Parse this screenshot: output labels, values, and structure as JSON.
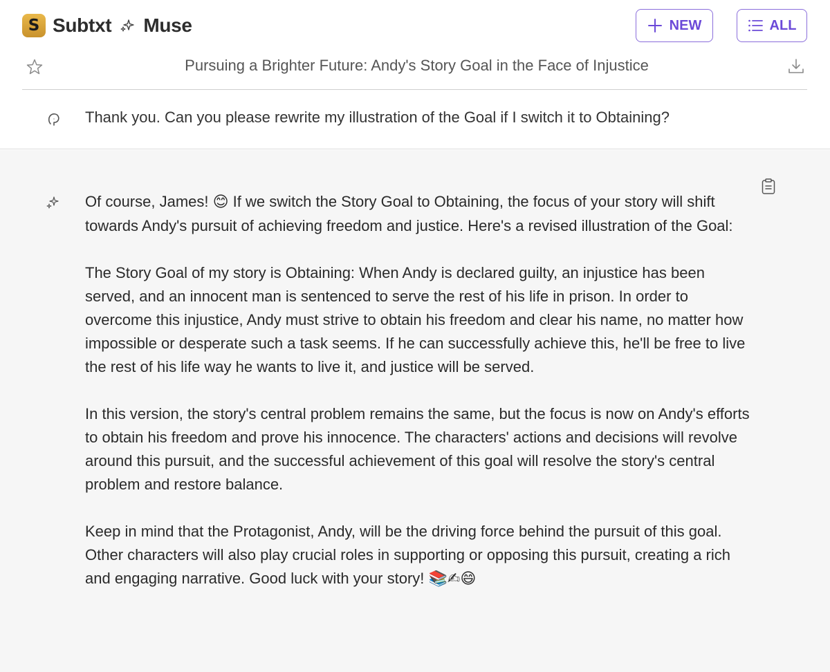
{
  "app": {
    "brand_name": "Subtxt",
    "brand_sub": "Muse",
    "logo_letter": "S",
    "accent": "#6b49d8"
  },
  "toolbar": {
    "new_label": "NEW",
    "all_label": "ALL"
  },
  "conversation": {
    "title": "Pursuing a Brighter Future: Andy's Story Goal in the Face of Injustice"
  },
  "user_message": {
    "text": "Thank you. Can you please rewrite my illustration of the Goal if I switch it to Obtaining?"
  },
  "assistant_message": {
    "p1_before_emoji": "Of course, James! ",
    "p1_emoji": "😊",
    "p1_after_emoji": " If we switch the Story Goal to Obtaining, the focus of your story will shift towards Andy's pursuit of achieving freedom and justice. Here's a revised illustration of the Goal:",
    "p2": "The Story Goal of my story is Obtaining: When Andy is declared guilty, an injustice has been served, and an innocent man is sentenced to serve the rest of his life in prison. In order to overcome this injustice, Andy must strive to obtain his freedom and clear his name, no matter how impossible or desperate such a task seems. If he can successfully achieve this, he'll be free to live the rest of his life way he wants to live it, and justice will be served.",
    "p3": "In this version, the story's central problem remains the same, but the focus is now on Andy's efforts to obtain his freedom and prove his innocence. The characters' actions and decisions will revolve around this pursuit, and the successful achievement of this goal will resolve the story's central problem and restore balance.",
    "p4_text": "Keep in mind that the Protagonist, Andy, will be the driving force behind the pursuit of this goal. Other characters will also play crucial roles in supporting or opposing this pursuit, creating a rich and engaging narrative. Good luck with your story! ",
    "p4_emoji": "📚✍😄"
  },
  "icons": {
    "logo": "subtxt-logo-icon",
    "brand_sparkle": "sparkle-icon",
    "new": "plus-icon",
    "all": "list-icon",
    "favorite": "star-icon",
    "download": "download-icon",
    "user": "user-speech-icon",
    "assistant": "sparkle-icon",
    "copy": "clipboard-icon"
  }
}
